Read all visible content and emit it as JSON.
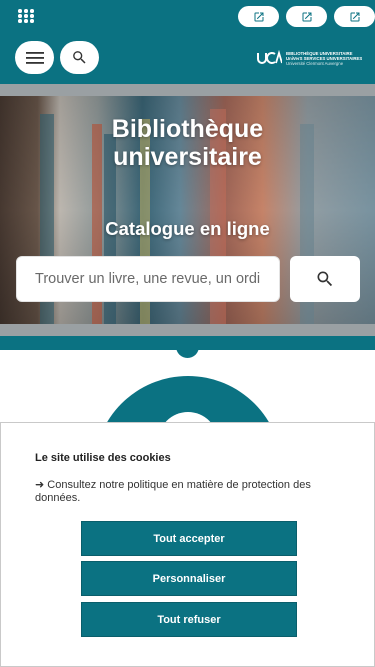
{
  "colors": {
    "brand_teal": "#0b7282",
    "white": "#ffffff"
  },
  "topbar": {
    "apps_icon": "apps-grid-icon",
    "external_links": [
      {
        "icon": "external-link-icon"
      },
      {
        "icon": "external-link-icon"
      },
      {
        "icon": "external-link-icon"
      }
    ]
  },
  "header": {
    "menu_icon": "hamburger-menu-icon",
    "search_icon": "search-icon",
    "logo": {
      "mark": "UCA",
      "line1": "BIBLIOTHÈQUE UNIVERSITAIRE",
      "line2": "UniVerS SERVICES UNIVERSITAIRES",
      "line3": "Université Clermont Auvergne"
    }
  },
  "hero": {
    "title_line1": "Bibliothèque",
    "title_line2": "universitaire",
    "subtitle": "Catalogue en ligne",
    "search_placeholder": "Trouver un livre, une revue, un ordi",
    "search_button_icon": "search-icon"
  },
  "cookie": {
    "title": "Le site utilise des cookies",
    "text": "➜ Consultez notre politique en matière de protection des données.",
    "accept_label": "Tout accepter",
    "customize_label": "Personnaliser",
    "refuse_label": "Tout refuser"
  }
}
